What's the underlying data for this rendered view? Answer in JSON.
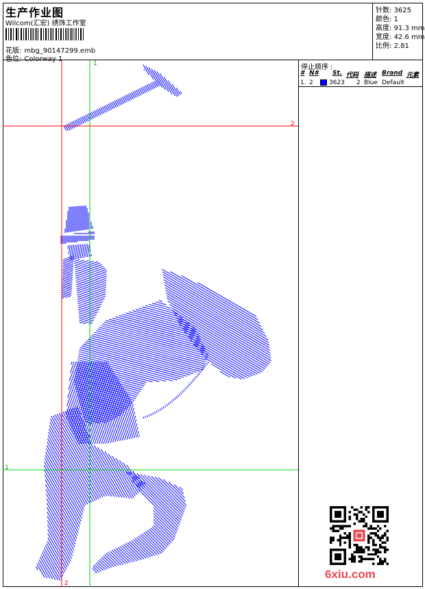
{
  "header": {
    "title": "生产作业图",
    "company": "Wilcom(汇宏) 绣饰工作室",
    "design_label": "花版:",
    "design_value": "mbg_90147299.emb",
    "colorway_label": "色位:",
    "colorway_value": "Colorway 1"
  },
  "stats": {
    "stitches_label": "针数:",
    "stitches_value": "3625",
    "colors_label": "颜色:",
    "colors_value": "1",
    "height_label": "高度:",
    "height_value": "91.3 mm",
    "width_label": "宽度:",
    "width_value": "42.6 mm",
    "ratio_label": "比例:",
    "ratio_value": "2.81"
  },
  "stop_sequence": {
    "heading": "停止顺序 :",
    "columns": {
      "hash": "#",
      "n": "N#",
      "st": "St.",
      "code": "代码",
      "desc": "描述",
      "brand": "Brand",
      "elem": "元素"
    },
    "rows": [
      {
        "num": "1.",
        "n": "2",
        "stitches": "3623",
        "code": "2",
        "desc": "Blue",
        "brand": "Default",
        "color": "#0000ff"
      }
    ]
  },
  "canvas": {
    "guide_labels": {
      "green_v": "1",
      "red_h": "2",
      "green_h": "1",
      "red_v": "2"
    },
    "guide_colors": {
      "red": "#ff0000",
      "green": "#00cc00"
    },
    "stitch_color": "#0000ff"
  },
  "watermark": {
    "text": "6xiu.com",
    "color": "#e8474f"
  }
}
